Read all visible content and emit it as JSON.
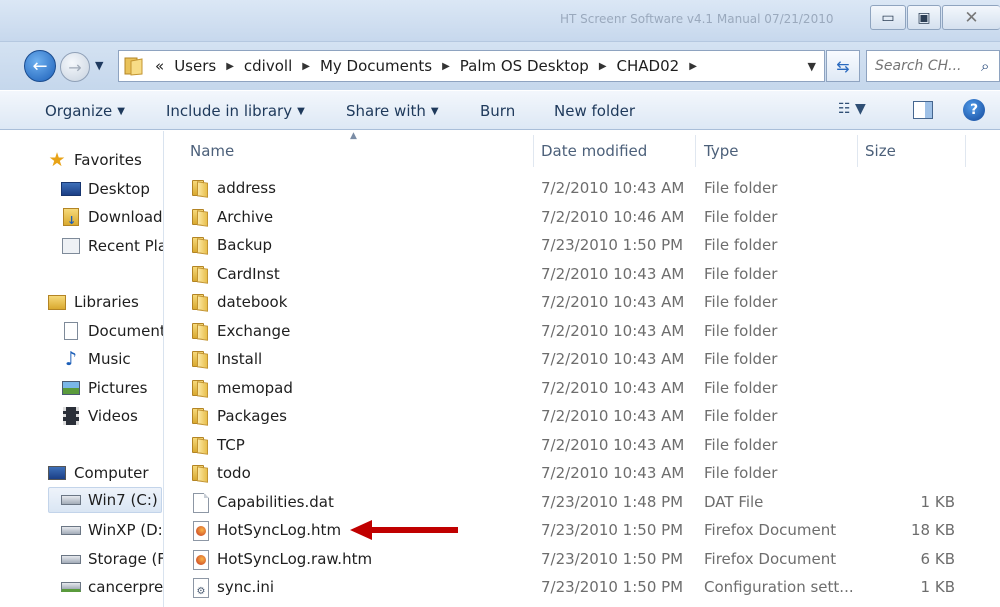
{
  "window": {
    "title": "HT Screenr Software v4.1 Manual 07/21/2010"
  },
  "title_buttons": {
    "minimize": "▭",
    "maximize": "▣",
    "close": "✕"
  },
  "address_bar": {
    "overflow": "«",
    "path": [
      "Users",
      "cdivoll",
      "My Documents",
      "Palm OS Desktop",
      "CHAD02"
    ],
    "search_placeholder": "Search CH..."
  },
  "command_bar": {
    "organize": "Organize",
    "include_in_library": "Include in library",
    "share_with": "Share with",
    "burn": "Burn",
    "new_folder": "New folder"
  },
  "nav_pane": {
    "favorites": {
      "label": "Favorites",
      "items": [
        "Desktop",
        "Downloads",
        "Recent Places"
      ]
    },
    "libraries": {
      "label": "Libraries",
      "items": [
        "Documents",
        "Music",
        "Pictures",
        "Videos"
      ]
    },
    "computer": {
      "label": "Computer",
      "items": [
        "Win7 (C:)",
        "WinXP (D:)",
        "Storage (F:)",
        "cancerprev"
      ]
    }
  },
  "columns": {
    "name": "Name",
    "date_modified": "Date modified",
    "type": "Type",
    "size": "Size"
  },
  "files": [
    {
      "name": "address",
      "date": "7/2/2010 10:43 AM",
      "type": "File folder",
      "size": "",
      "icon": "folder-icon"
    },
    {
      "name": "Archive",
      "date": "7/2/2010 10:46 AM",
      "type": "File folder",
      "size": "",
      "icon": "folder-icon"
    },
    {
      "name": "Backup",
      "date": "7/23/2010 1:50 PM",
      "type": "File folder",
      "size": "",
      "icon": "folder-icon"
    },
    {
      "name": "CardInst",
      "date": "7/2/2010 10:43 AM",
      "type": "File folder",
      "size": "",
      "icon": "folder-icon"
    },
    {
      "name": "datebook",
      "date": "7/2/2010 10:43 AM",
      "type": "File folder",
      "size": "",
      "icon": "folder-icon"
    },
    {
      "name": "Exchange",
      "date": "7/2/2010 10:43 AM",
      "type": "File folder",
      "size": "",
      "icon": "folder-icon"
    },
    {
      "name": "Install",
      "date": "7/2/2010 10:43 AM",
      "type": "File folder",
      "size": "",
      "icon": "folder-icon"
    },
    {
      "name": "memopad",
      "date": "7/2/2010 10:43 AM",
      "type": "File folder",
      "size": "",
      "icon": "folder-icon"
    },
    {
      "name": "Packages",
      "date": "7/2/2010 10:43 AM",
      "type": "File folder",
      "size": "",
      "icon": "folder-icon"
    },
    {
      "name": "TCP",
      "date": "7/2/2010 10:43 AM",
      "type": "File folder",
      "size": "",
      "icon": "folder-icon"
    },
    {
      "name": "todo",
      "date": "7/2/2010 10:43 AM",
      "type": "File folder",
      "size": "",
      "icon": "folder-icon"
    },
    {
      "name": "Capabilities.dat",
      "date": "7/23/2010 1:48 PM",
      "type": "DAT File",
      "size": "1 KB",
      "icon": "document-icon"
    },
    {
      "name": "HotSyncLog.htm",
      "date": "7/23/2010 1:50 PM",
      "type": "Firefox Document",
      "size": "18 KB",
      "icon": "firefox-document-icon"
    },
    {
      "name": "HotSyncLog.raw.htm",
      "date": "7/23/2010 1:50 PM",
      "type": "Firefox Document",
      "size": "6 KB",
      "icon": "firefox-document-icon"
    },
    {
      "name": "sync.ini",
      "date": "7/23/2010 1:50 PM",
      "type": "Configuration sett...",
      "size": "1 KB",
      "icon": "config-file-icon"
    }
  ],
  "colors": {
    "accent": "#1e395b",
    "highlight_arrow": "#c00000",
    "selection": "#dae6f4"
  }
}
